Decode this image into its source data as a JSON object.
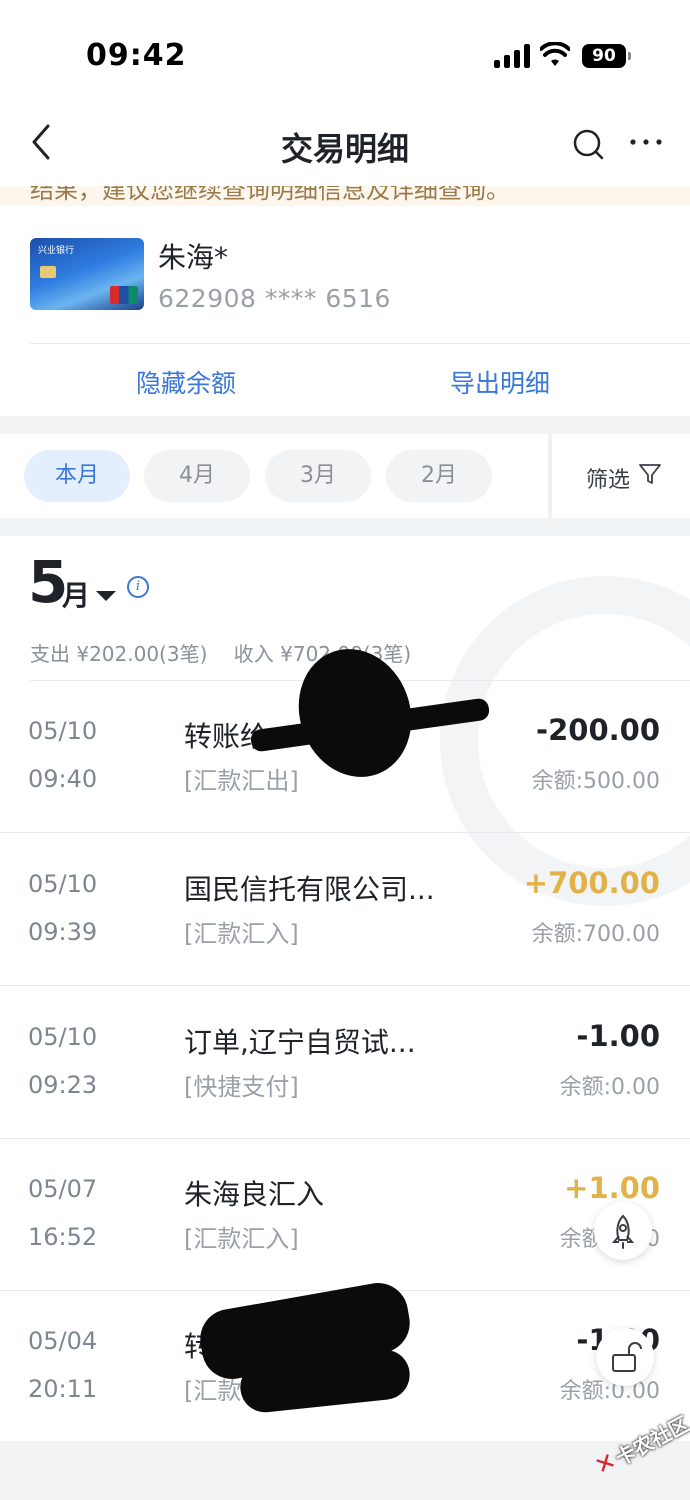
{
  "status_bar": {
    "time": "09:42",
    "battery": "90"
  },
  "nav": {
    "title": "交易明细"
  },
  "notice": {
    "text": "结果，建议您继续查询明细信息及详细查询。"
  },
  "card": {
    "bank_name": "兴业银行",
    "holder": "朱海*",
    "number": "622908  ****  6516"
  },
  "actions": {
    "hide_balance": "隐藏余额",
    "export_detail": "导出明细"
  },
  "tabs": [
    {
      "label": "本月",
      "active": true
    },
    {
      "label": "4月",
      "active": false
    },
    {
      "label": "3月",
      "active": false
    },
    {
      "label": "2月",
      "active": false
    }
  ],
  "filter": {
    "label": "筛选"
  },
  "month": {
    "number": "5",
    "unit": "月"
  },
  "summary": {
    "expense": "支出 ¥202.00(3笔)",
    "income": "收入 ¥702.00(3笔)"
  },
  "transactions": [
    {
      "date": "05/10",
      "time": "09:40",
      "title": "转账给",
      "type": "[汇款汇出]",
      "amount": "-200.00",
      "balance": "余额:500.00",
      "income": false
    },
    {
      "date": "05/10",
      "time": "09:39",
      "title": "国民信托有限公司...",
      "type": "[汇款汇入]",
      "amount": "+700.00",
      "balance": "余额:700.00",
      "income": true
    },
    {
      "date": "05/10",
      "time": "09:23",
      "title": "订单,辽宁自贸试...",
      "type": "[快捷支付]",
      "amount": "-1.00",
      "balance": "余额:0.00",
      "income": false
    },
    {
      "date": "05/07",
      "time": "16:52",
      "title": "朱海良汇入",
      "type": "[汇款汇入]",
      "amount": "+1.00",
      "balance": "余额:1.00",
      "income": true
    },
    {
      "date": "05/04",
      "time": "20:11",
      "title": "转",
      "type": "[汇款汇出]",
      "amount": "-1.00",
      "balance": "余额:0.00",
      "income": false
    }
  ],
  "watermark": {
    "text": "卡农社区"
  },
  "colors": {
    "accent": "#3a78d8",
    "income": "#e2b24a",
    "text": "#1f2329",
    "muted": "#9aa0a8"
  },
  "icons": [
    "back-icon",
    "search-icon",
    "more-icon",
    "filter-icon",
    "info-icon",
    "rocket-icon",
    "unlock-icon"
  ]
}
